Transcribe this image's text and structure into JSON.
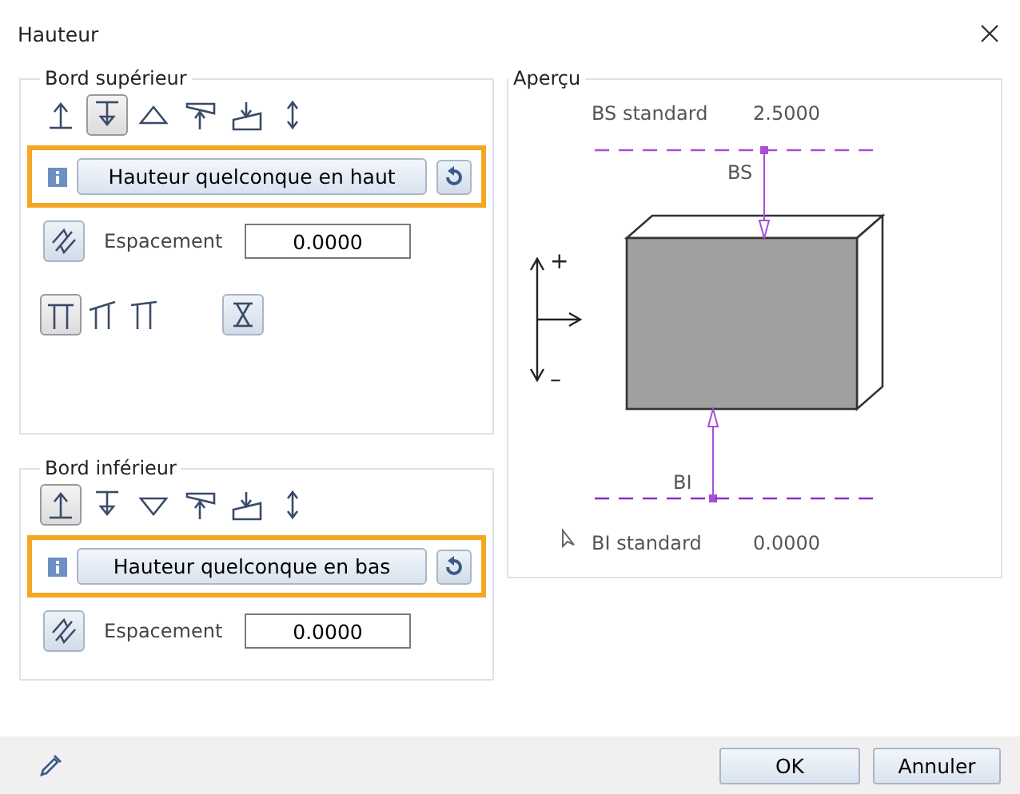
{
  "window": {
    "title": "Hauteur"
  },
  "sections": [
    {
      "legend": "Bord supérieur",
      "tools": [
        {
          "kind": "up-line",
          "selected": false
        },
        {
          "kind": "down-line",
          "selected": true
        },
        {
          "kind": "triangle-up",
          "selected": false
        },
        {
          "kind": "slab",
          "selected": false
        },
        {
          "kind": "slope",
          "selected": false
        },
        {
          "kind": "double",
          "selected": false
        }
      ],
      "mode_button": "Hauteur quelconque en haut",
      "highlighted": true,
      "spacing_label": "Espacement",
      "spacing_value": "0.0000",
      "profiles": [
        {
          "kind": "flat",
          "selected": true
        },
        {
          "kind": "slope-left",
          "selected": false
        },
        {
          "kind": "slope-right",
          "selected": false
        }
      ]
    },
    {
      "legend": "Bord inférieur",
      "tools": [
        {
          "kind": "up-line",
          "selected": true
        },
        {
          "kind": "down-line",
          "selected": false
        },
        {
          "kind": "triangle-down",
          "selected": false
        },
        {
          "kind": "slab",
          "selected": false
        },
        {
          "kind": "slope",
          "selected": false
        },
        {
          "kind": "double",
          "selected": false
        }
      ],
      "mode_button": "Hauteur quelconque en bas",
      "highlighted": true,
      "spacing_label": "Espacement",
      "spacing_value": "0.0000"
    }
  ],
  "preview": {
    "legend": "Aperçu",
    "top_label": "BS standard",
    "top_value": "2.5000",
    "top_tag": "BS",
    "plus": "+",
    "minus": "–",
    "bottom_tag": "BI",
    "bottom_label": "BI standard",
    "bottom_value": "0.0000"
  },
  "buttons": [
    "OK",
    "Annuler"
  ]
}
